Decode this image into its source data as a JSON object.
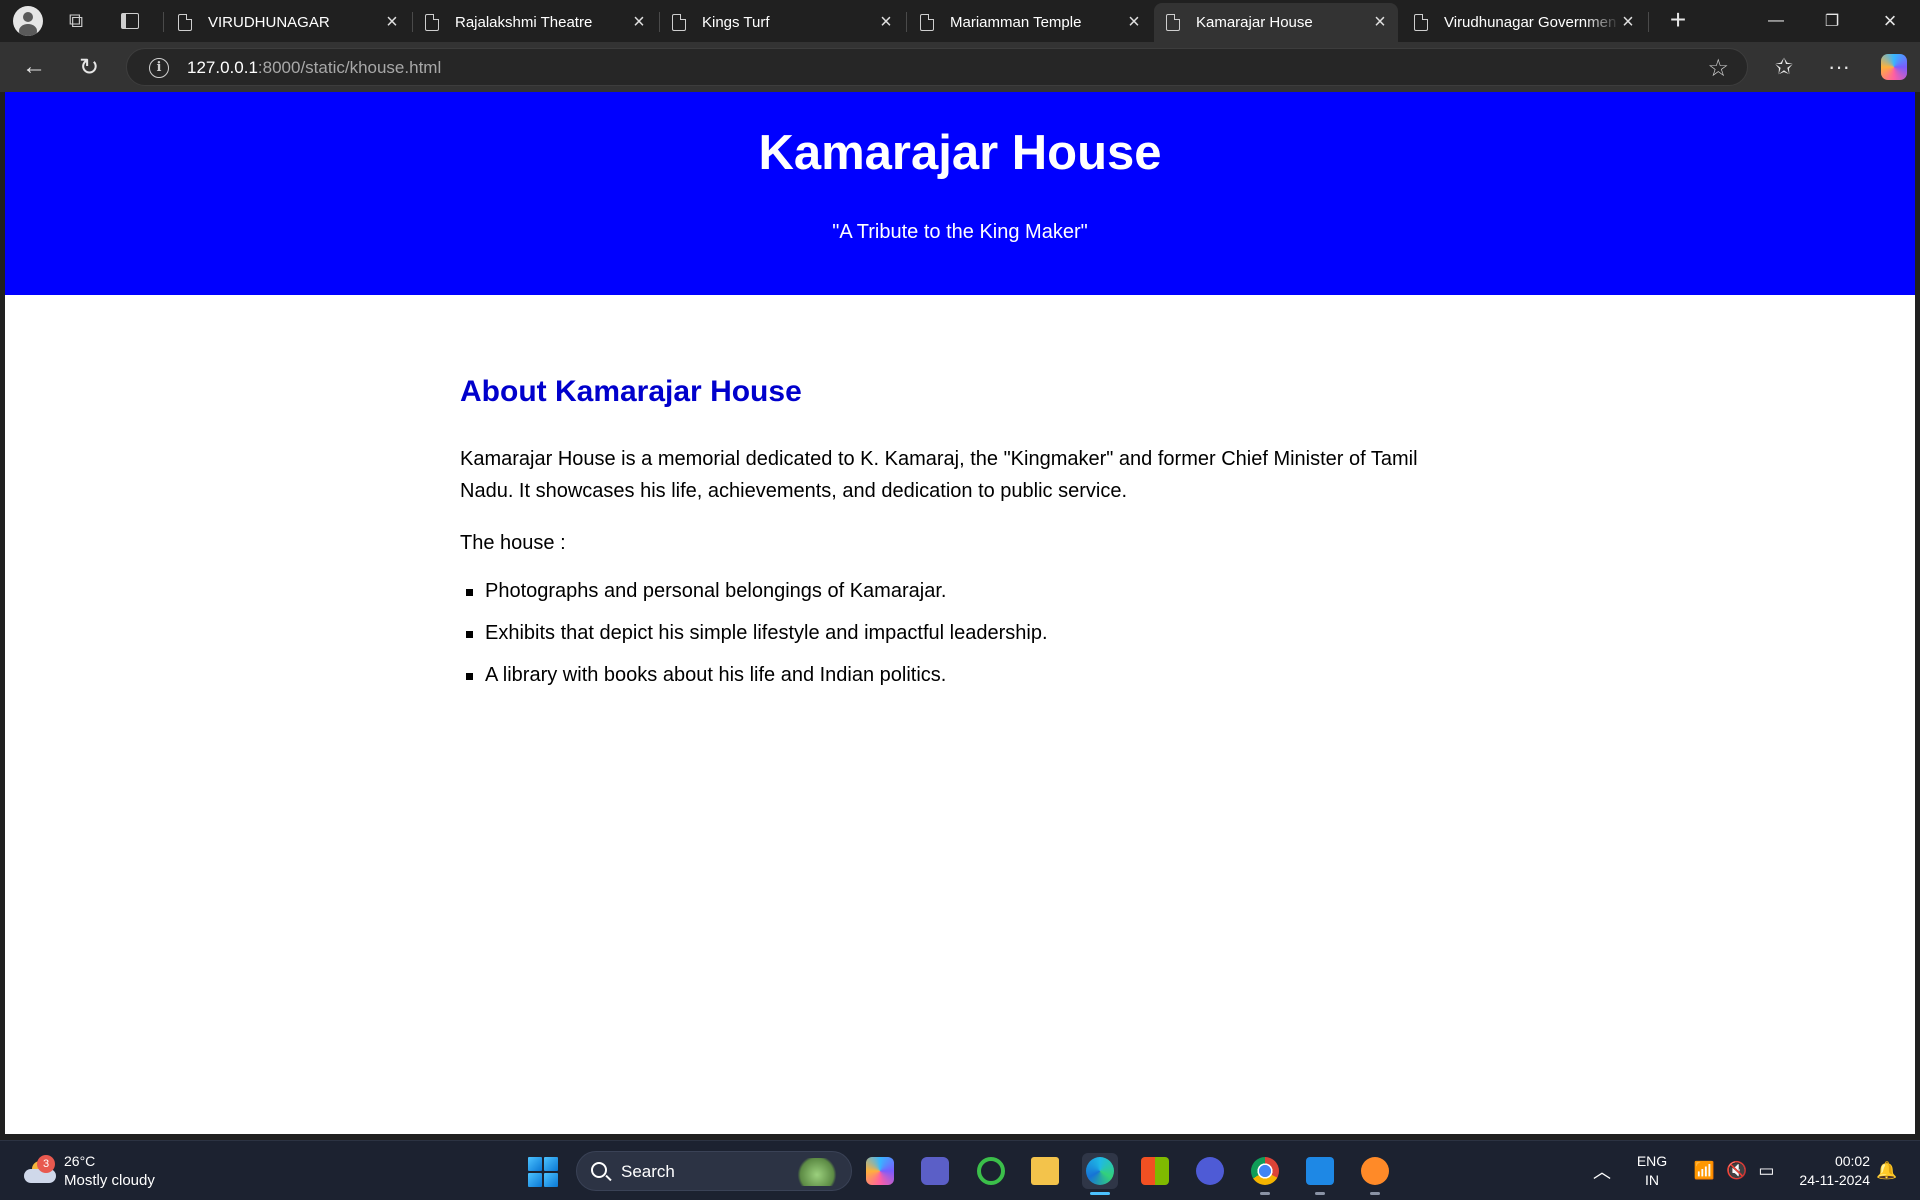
{
  "browser": {
    "tabs": [
      {
        "title": "VIRUDHUNAGAR",
        "active": false
      },
      {
        "title": "Rajalakshmi Theatre",
        "active": false
      },
      {
        "title": "Kings Turf",
        "active": false
      },
      {
        "title": "Mariamman Temple",
        "active": false
      },
      {
        "title": "Kamarajar House",
        "active": true
      },
      {
        "title": "Virudhunagar Governmen",
        "active": false
      }
    ],
    "url_host": "127.0.0.1",
    "url_path": ":8000/static/khouse.html"
  },
  "page": {
    "hero": {
      "title": "Kamarajar House",
      "tagline": "\"A Tribute to the King Maker\"",
      "background": "#0000ff"
    },
    "about": {
      "heading": "About Kamarajar House",
      "intro": "Kamarajar House is a memorial dedicated to K. Kamaraj, the \"Kingmaker\" and former Chief Minister of Tamil Nadu. It showcases his life, achievements, and dedication to public service.",
      "list_lead": "The house :",
      "items": [
        "Photographs and personal belongings of Kamarajar.",
        "Exhibits that depict his simple lifestyle and impactful leadership.",
        "A library with books about his life and Indian politics."
      ]
    }
  },
  "taskbar": {
    "weather": {
      "temp": "26°C",
      "condition": "Mostly cloudy",
      "badge": "3"
    },
    "search_label": "Search",
    "apps": [
      "copilot-icon",
      "teams-icon",
      "refresh-app-icon",
      "file-explorer-icon",
      "edge-icon",
      "store-icon",
      "vpn-icon",
      "chrome-icon",
      "vscode-icon",
      "sublime-icon"
    ],
    "language": {
      "line1": "ENG",
      "line2": "IN"
    },
    "clock": {
      "time": "00:02",
      "date": "24-11-2024"
    }
  }
}
